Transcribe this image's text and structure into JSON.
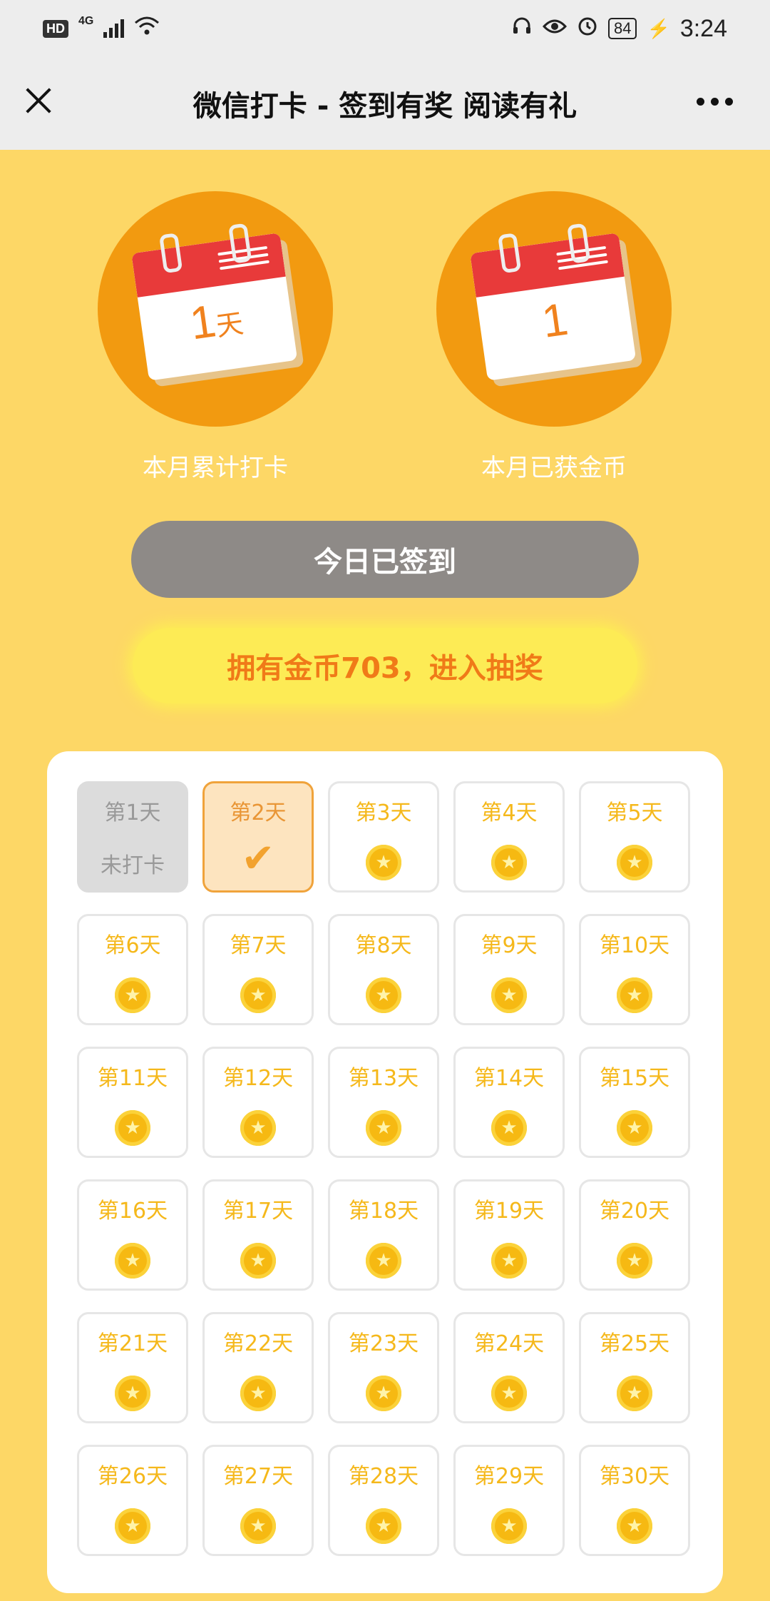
{
  "status_bar": {
    "hd": "HD",
    "network": "4G",
    "battery": "84",
    "time": "3:24",
    "icons": [
      "headset-icon",
      "eye-icon",
      "alarm-icon",
      "charging-icon"
    ]
  },
  "header": {
    "title": "微信打卡 - 签到有奖 阅读有礼"
  },
  "stats": {
    "days_value": "1",
    "days_unit": "天",
    "days_label": "本月累计打卡",
    "coins_value": "1",
    "coins_label": "本月已获金币"
  },
  "signed_button": "今日已签到",
  "lottery_button": "拥有金币703，进入抽奖",
  "colors": {
    "background": "#FDD766",
    "accent": "#F29A10",
    "coin": "#F6B912",
    "missed": "#DCDCDC"
  },
  "days": [
    {
      "label": "第1天",
      "state": "missed",
      "status": "未打卡"
    },
    {
      "label": "第2天",
      "state": "checked"
    },
    {
      "label": "第3天",
      "state": "coin"
    },
    {
      "label": "第4天",
      "state": "coin"
    },
    {
      "label": "第5天",
      "state": "coin"
    },
    {
      "label": "第6天",
      "state": "coin"
    },
    {
      "label": "第7天",
      "state": "coin"
    },
    {
      "label": "第8天",
      "state": "coin"
    },
    {
      "label": "第9天",
      "state": "coin"
    },
    {
      "label": "第10天",
      "state": "coin"
    },
    {
      "label": "第11天",
      "state": "coin"
    },
    {
      "label": "第12天",
      "state": "coin"
    },
    {
      "label": "第13天",
      "state": "coin"
    },
    {
      "label": "第14天",
      "state": "coin"
    },
    {
      "label": "第15天",
      "state": "coin"
    },
    {
      "label": "第16天",
      "state": "coin"
    },
    {
      "label": "第17天",
      "state": "coin"
    },
    {
      "label": "第18天",
      "state": "coin"
    },
    {
      "label": "第19天",
      "state": "coin"
    },
    {
      "label": "第20天",
      "state": "coin"
    },
    {
      "label": "第21天",
      "state": "coin"
    },
    {
      "label": "第22天",
      "state": "coin"
    },
    {
      "label": "第23天",
      "state": "coin"
    },
    {
      "label": "第24天",
      "state": "coin"
    },
    {
      "label": "第25天",
      "state": "coin"
    },
    {
      "label": "第26天",
      "state": "coin"
    },
    {
      "label": "第27天",
      "state": "coin"
    },
    {
      "label": "第28天",
      "state": "coin"
    },
    {
      "label": "第29天",
      "state": "coin"
    },
    {
      "label": "第30天",
      "state": "coin"
    }
  ]
}
